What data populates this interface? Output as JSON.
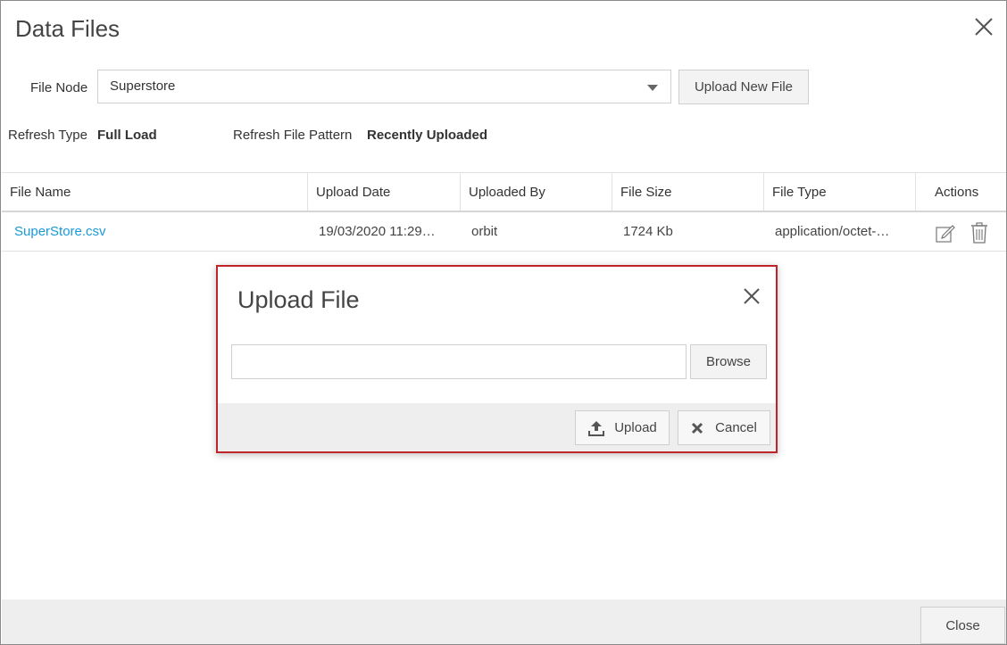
{
  "dialog": {
    "title": "Data Files"
  },
  "file_node": {
    "label": "File Node",
    "selected": "Superstore"
  },
  "upload_new_file_label": "Upload New File",
  "refresh": {
    "type_label": "Refresh Type",
    "type_value": "Full Load",
    "pattern_label": "Refresh File Pattern",
    "pattern_value": "Recently Uploaded"
  },
  "table": {
    "headers": [
      "File Name",
      "Upload Date",
      "Uploaded By",
      "File Size",
      "File Type",
      "Actions"
    ],
    "rows": [
      {
        "file_name": "SuperStore.csv",
        "upload_date": "19/03/2020 11:29…",
        "uploaded_by": "orbit",
        "file_size": "1724 Kb",
        "file_type": "application/octet-…"
      }
    ]
  },
  "upload_modal": {
    "title": "Upload File",
    "file_value": "",
    "browse_label": "Browse",
    "upload_label": "Upload",
    "cancel_label": "Cancel"
  },
  "footer": {
    "close_label": "Close"
  },
  "colors": {
    "link": "#1a9ad6",
    "modal_border": "#c0242a",
    "footer_bg": "#eeeeee"
  },
  "icons": [
    "close-icon",
    "chevron-down-icon",
    "edit-icon",
    "trash-icon",
    "upload-icon",
    "cancel-x-icon"
  ]
}
